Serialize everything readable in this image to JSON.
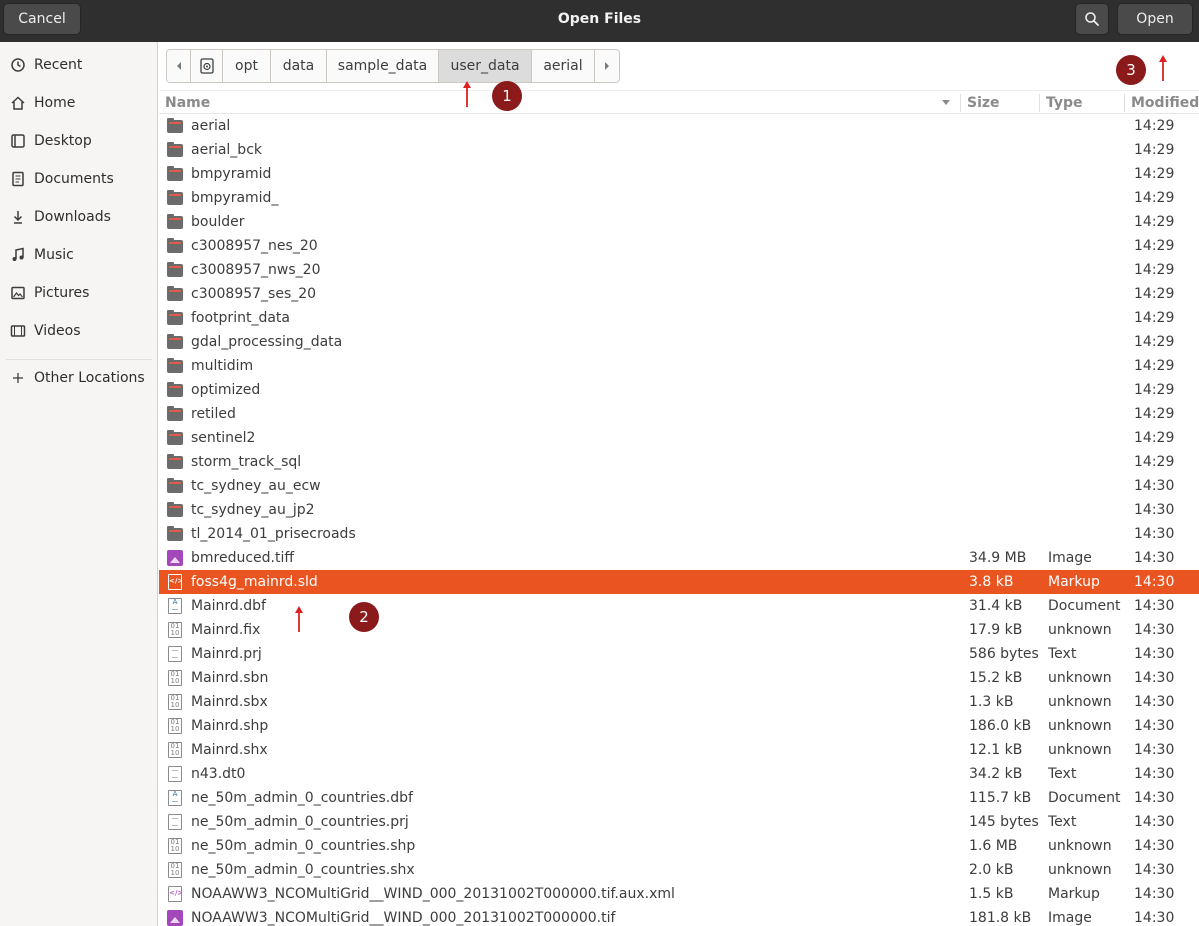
{
  "header": {
    "cancel_label": "Cancel",
    "title": "Open Files",
    "open_label": "Open"
  },
  "sidebar": {
    "items": [
      {
        "label": "Recent",
        "icon": "clock-icon"
      },
      {
        "label": "Home",
        "icon": "home-icon"
      },
      {
        "label": "Desktop",
        "icon": "desktop-icon"
      },
      {
        "label": "Documents",
        "icon": "documents-icon"
      },
      {
        "label": "Downloads",
        "icon": "download-icon"
      },
      {
        "label": "Music",
        "icon": "music-icon"
      },
      {
        "label": "Pictures",
        "icon": "pictures-icon"
      },
      {
        "label": "Videos",
        "icon": "videos-icon"
      },
      {
        "label": "Other Locations",
        "icon": "plus-icon"
      }
    ]
  },
  "pathbar": {
    "segments": [
      "opt",
      "data",
      "sample_data",
      "user_data",
      "aerial"
    ],
    "active": "user_data"
  },
  "columns": {
    "name": "Name",
    "size": "Size",
    "type": "Type",
    "modified": "Modified"
  },
  "files": [
    {
      "name": "aerial",
      "kind": "folder",
      "size": "",
      "type": "",
      "modified": "14:29"
    },
    {
      "name": "aerial_bck",
      "kind": "folder",
      "size": "",
      "type": "",
      "modified": "14:29"
    },
    {
      "name": "bmpyramid",
      "kind": "folder",
      "size": "",
      "type": "",
      "modified": "14:29"
    },
    {
      "name": "bmpyramid_",
      "kind": "folder",
      "size": "",
      "type": "",
      "modified": "14:29"
    },
    {
      "name": "boulder",
      "kind": "folder",
      "size": "",
      "type": "",
      "modified": "14:29"
    },
    {
      "name": "c3008957_nes_20",
      "kind": "folder",
      "size": "",
      "type": "",
      "modified": "14:29"
    },
    {
      "name": "c3008957_nws_20",
      "kind": "folder",
      "size": "",
      "type": "",
      "modified": "14:29"
    },
    {
      "name": "c3008957_ses_20",
      "kind": "folder",
      "size": "",
      "type": "",
      "modified": "14:29"
    },
    {
      "name": "footprint_data",
      "kind": "folder",
      "size": "",
      "type": "",
      "modified": "14:29"
    },
    {
      "name": "gdal_processing_data",
      "kind": "folder",
      "size": "",
      "type": "",
      "modified": "14:29"
    },
    {
      "name": "multidim",
      "kind": "folder",
      "size": "",
      "type": "",
      "modified": "14:29"
    },
    {
      "name": "optimized",
      "kind": "folder",
      "size": "",
      "type": "",
      "modified": "14:29"
    },
    {
      "name": "retiled",
      "kind": "folder",
      "size": "",
      "type": "",
      "modified": "14:29"
    },
    {
      "name": "sentinel2",
      "kind": "folder",
      "size": "",
      "type": "",
      "modified": "14:29"
    },
    {
      "name": "storm_track_sql",
      "kind": "folder",
      "size": "",
      "type": "",
      "modified": "14:29"
    },
    {
      "name": "tc_sydney_au_ecw",
      "kind": "folder",
      "size": "",
      "type": "",
      "modified": "14:30"
    },
    {
      "name": "tc_sydney_au_jp2",
      "kind": "folder",
      "size": "",
      "type": "",
      "modified": "14:30"
    },
    {
      "name": "tl_2014_01_prisecroads",
      "kind": "folder",
      "size": "",
      "type": "",
      "modified": "14:30"
    },
    {
      "name": "bmreduced.tiff",
      "kind": "image",
      "size": "34.9 MB",
      "type": "Image",
      "modified": "14:30"
    },
    {
      "name": "foss4g_mainrd.sld",
      "kind": "markup",
      "size": "3.8 kB",
      "type": "Markup",
      "modified": "14:30",
      "selected": true
    },
    {
      "name": "Mainrd.dbf",
      "kind": "document",
      "size": "31.4 kB",
      "type": "Document",
      "modified": "14:30"
    },
    {
      "name": "Mainrd.fix",
      "kind": "binary",
      "size": "17.9 kB",
      "type": "unknown",
      "modified": "14:30"
    },
    {
      "name": "Mainrd.prj",
      "kind": "text",
      "size": "586 bytes",
      "type": "Text",
      "modified": "14:30"
    },
    {
      "name": "Mainrd.sbn",
      "kind": "binary",
      "size": "15.2 kB",
      "type": "unknown",
      "modified": "14:30"
    },
    {
      "name": "Mainrd.sbx",
      "kind": "binary",
      "size": "1.3 kB",
      "type": "unknown",
      "modified": "14:30"
    },
    {
      "name": "Mainrd.shp",
      "kind": "binary",
      "size": "186.0 kB",
      "type": "unknown",
      "modified": "14:30"
    },
    {
      "name": "Mainrd.shx",
      "kind": "binary",
      "size": "12.1 kB",
      "type": "unknown",
      "modified": "14:30"
    },
    {
      "name": "n43.dt0",
      "kind": "text",
      "size": "34.2 kB",
      "type": "Text",
      "modified": "14:30"
    },
    {
      "name": "ne_50m_admin_0_countries.dbf",
      "kind": "document",
      "size": "115.7 kB",
      "type": "Document",
      "modified": "14:30"
    },
    {
      "name": "ne_50m_admin_0_countries.prj",
      "kind": "text",
      "size": "145 bytes",
      "type": "Text",
      "modified": "14:30"
    },
    {
      "name": "ne_50m_admin_0_countries.shp",
      "kind": "binary",
      "size": "1.6 MB",
      "type": "unknown",
      "modified": "14:30"
    },
    {
      "name": "ne_50m_admin_0_countries.shx",
      "kind": "binary",
      "size": "2.0 kB",
      "type": "unknown",
      "modified": "14:30"
    },
    {
      "name": "NOAAWW3_NCOMultiGrid__WIND_000_20131002T000000.tif.aux.xml",
      "kind": "markup",
      "size": "1.5 kB",
      "type": "Markup",
      "modified": "14:30"
    },
    {
      "name": "NOAAWW3_NCOMultiGrid__WIND_000_20131002T000000.tif",
      "kind": "image",
      "size": "181.8 kB",
      "type": "Image",
      "modified": "14:30"
    }
  ],
  "annotations": {
    "badge1": "1",
    "badge2": "2",
    "badge3": "3",
    "color": "#8b1a1a"
  },
  "colors": {
    "headerbar": "#2f2f2f",
    "selection": "#e95420",
    "sidebar": "#f6f5f4"
  }
}
